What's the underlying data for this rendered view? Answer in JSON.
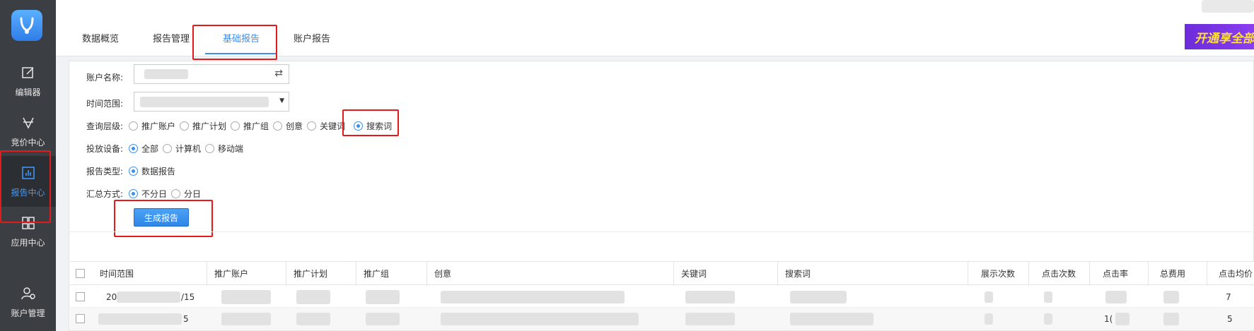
{
  "sidebar": {
    "items": [
      {
        "label": "编辑器",
        "icon": "edit-icon"
      },
      {
        "label": "竞价中心",
        "icon": "bid-icon"
      },
      {
        "label": "报告中心",
        "icon": "report-chart-icon"
      },
      {
        "label": "应用中心",
        "icon": "apps-grid-icon"
      },
      {
        "label": "账户管理",
        "icon": "user-gear-icon"
      }
    ]
  },
  "tabs": [
    {
      "label": "数据概览"
    },
    {
      "label": "报告管理"
    },
    {
      "label": "基础报告"
    },
    {
      "label": "账户报告"
    }
  ],
  "promo_text": "开通享全部功能 每",
  "form": {
    "account_label": "账户名称:",
    "time_label": "时间范围:",
    "level_label": "查询层级:",
    "level_options": [
      "推广账户",
      "推广计划",
      "推广组",
      "创意",
      "关键词",
      "搜索词"
    ],
    "device_label": "投放设备:",
    "device_options": [
      "全部",
      "计算机",
      "移动端"
    ],
    "type_label": "报告类型:",
    "type_options": [
      "数据报告"
    ],
    "summary_label": "汇总方式:",
    "summary_options": [
      "不分日",
      "分日"
    ],
    "generate_button": "生成报告"
  },
  "table": {
    "headers": [
      "时间范围",
      "推广账户",
      "推广计划",
      "推广组",
      "创意",
      "关键词",
      "搜索词",
      "展示次数",
      "点击次数",
      "点击率",
      "总费用",
      "点击均价"
    ],
    "rows": [
      {
        "time_prefix": "20",
        "time_suffix": "/15",
        "ctr": "",
        "cpc": "7"
      },
      {
        "time_prefix": "",
        "time_suffix": "5",
        "ctr": "1(",
        "cpc": "5"
      }
    ]
  },
  "colors": {
    "sidebar_bg": "#3b3e43",
    "accent": "#3e8ee8",
    "highlight": "#e31b1b"
  }
}
